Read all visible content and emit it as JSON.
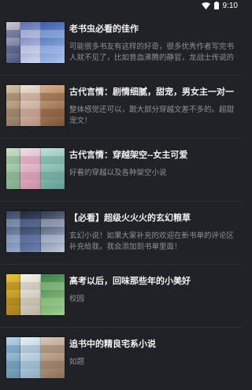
{
  "status_bar": {
    "time": "9:10",
    "icons": [
      "wifi-icon",
      "battery-icon"
    ]
  },
  "booklists": [
    {
      "title": "老书虫必看的佳作",
      "description": "可能很多书友有这样的好奇，很多优秀作者写完书人就不见了，比如曾血沸腾的静官，龙战士传说的半...",
      "covers": [
        {
          "base": "#c9c9d2",
          "accent": "#3f4a7a"
        },
        {
          "base": "#5c6fb0",
          "accent": "#d8dcf0"
        },
        {
          "base": "#3f5fa8",
          "accent": "#a8c4ee"
        }
      ]
    },
    {
      "title": "古代言情：剧情细腻，甜宠，男女主一对一",
      "description": "整体感觉还可以，跟大部分穿越文差不多的。超甜宠文！",
      "covers": [
        {
          "base": "#d5c3aa",
          "accent": "#8a6e57"
        },
        {
          "base": "#e9e2d6",
          "accent": "#b58c7a"
        },
        {
          "base": "#d9b089",
          "accent": "#7a5337"
        }
      ]
    },
    {
      "title": "古代言情：穿越架空--女主可爱",
      "description": "好看的穿越以及各种架空小说",
      "covers": [
        {
          "base": "#c8e0c6",
          "accent": "#7aa384"
        },
        {
          "base": "#f0dce4",
          "accent": "#c98aa2"
        },
        {
          "base": "#bde0d8",
          "accent": "#5f9c8f"
        }
      ]
    },
    {
      "title": "【必看】超级火火火的玄幻粮草",
      "description": "玄幻小说！如果大家补充的欢迎在新书单的评论区补充给我，我会添加到书单里面！",
      "covers": [
        {
          "base": "#3a4660",
          "accent": "#9fb3d6"
        },
        {
          "base": "#22283a",
          "accent": "#6f86b8"
        },
        {
          "base": "#2d3a52",
          "accent": "#c0cbe0"
        }
      ]
    },
    {
      "title": "高考以后，回味那些年的小美好",
      "description": "校园",
      "covers": [
        {
          "base": "#e7c23a",
          "accent": "#a0781c"
        },
        {
          "base": "#f3f1ea",
          "accent": "#b8b2a0"
        },
        {
          "base": "#3f7d4c",
          "accent": "#9fd08e"
        }
      ]
    },
    {
      "title": "追书中的精良宅系小说",
      "description": "如题",
      "covers": [
        {
          "base": "#b8d4e8",
          "accent": "#5e88a8"
        },
        {
          "base": "#e6eef4",
          "accent": "#8aa8c0"
        },
        {
          "base": "#d8c8b8",
          "accent": "#8c6e56"
        }
      ]
    }
  ]
}
